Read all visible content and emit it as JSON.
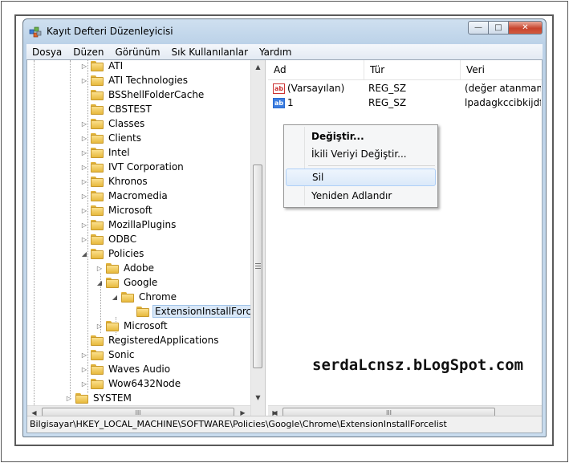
{
  "window": {
    "title": "Kayıt Defteri Düzenleyicisi",
    "icon": "registry-editor-icon",
    "controls": {
      "minimize": "—",
      "maximize": "□",
      "close": "✕"
    }
  },
  "menu": [
    "Dosya",
    "Düzen",
    "Görünüm",
    "Sık Kullanılanlar",
    "Yardım"
  ],
  "tree": {
    "items": [
      {
        "label": "ATI",
        "expander": "▷"
      },
      {
        "label": "ATI Technologies",
        "expander": "▷"
      },
      {
        "label": "BSShellFolderCache",
        "expander": ""
      },
      {
        "label": "CBSTEST",
        "expander": ""
      },
      {
        "label": "Classes",
        "expander": "▷"
      },
      {
        "label": "Clients",
        "expander": "▷"
      },
      {
        "label": "Intel",
        "expander": "▷"
      },
      {
        "label": "IVT Corporation",
        "expander": "▷"
      },
      {
        "label": "Khronos",
        "expander": "▷"
      },
      {
        "label": "Macromedia",
        "expander": "▷"
      },
      {
        "label": "Microsoft",
        "expander": "▷"
      },
      {
        "label": "MozillaPlugins",
        "expander": "▷"
      },
      {
        "label": "ODBC",
        "expander": "▷"
      },
      {
        "label": "Policies",
        "expander": "◢"
      },
      {
        "label": "Adobe",
        "expander": "▷"
      },
      {
        "label": "Google",
        "expander": "◢"
      },
      {
        "label": "Chrome",
        "expander": "◢"
      },
      {
        "label": "ExtensionInstallForceli",
        "expander": "",
        "selected": true
      },
      {
        "label": "Microsoft",
        "expander": "▷"
      },
      {
        "label": "RegisteredApplications",
        "expander": ""
      },
      {
        "label": "Sonic",
        "expander": "▷"
      },
      {
        "label": "Waves Audio",
        "expander": "▷"
      },
      {
        "label": "Wow6432Node",
        "expander": "▷"
      },
      {
        "label": "SYSTEM",
        "expander": "▷"
      }
    ],
    "hscroll_glyph": "III"
  },
  "list": {
    "columns": [
      "Ad",
      "Tür",
      "Veri"
    ],
    "rows": [
      {
        "icon": "ab",
        "name": "(Varsayılan)",
        "type": "REG_SZ",
        "data": "(değer atanmamı"
      },
      {
        "icon": "ab",
        "name": "1",
        "type": "REG_SZ",
        "data": "lpadagkccibkijdfl"
      }
    ],
    "hscroll_glyph": "III"
  },
  "context_menu": {
    "items": [
      {
        "label": "Değiştir...",
        "bold": true
      },
      {
        "label": "İkili Veriyi Değiştir..."
      },
      {
        "label": "Sil",
        "hover": true
      },
      {
        "label": "Yeniden Adlandır"
      }
    ]
  },
  "watermark": "serdaLcnsz.bLogSpot.com",
  "status": "Bilgisayar\\HKEY_LOCAL_MACHINE\\SOFTWARE\\Policies\\Google\\Chrome\\ExtensionInstallForcelist"
}
